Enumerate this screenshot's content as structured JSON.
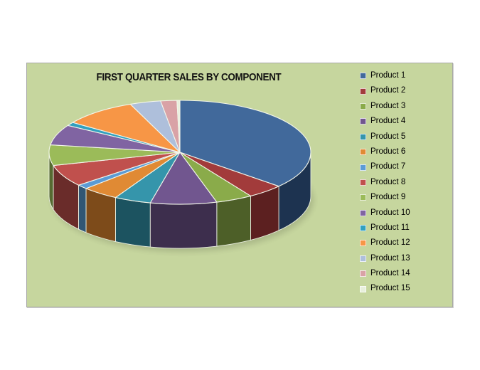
{
  "chart_data": {
    "type": "pie",
    "title": "FIRST QUARTER SALES BY COMPONENT",
    "three_d": true,
    "start_angle_deg": 0,
    "direction": "clockwise",
    "legend_position": "right",
    "grid": false,
    "categories": [
      "Product 1",
      "Product 2",
      "Product 3",
      "Product 4",
      "Product 5",
      "Product 6",
      "Product 7",
      "Product 8",
      "Product 9",
      "Product 10",
      "Product 11",
      "Product 12",
      "Product 13",
      "Product 14",
      "Product 15"
    ],
    "values": [
      40,
      5,
      5,
      9,
      5,
      5,
      1.5,
      7.5,
      7,
      7,
      1.2,
      10,
      4.2,
      2.2,
      0.4
    ],
    "colors": [
      "#41699b",
      "#a23b3b",
      "#8aab4a",
      "#71568f",
      "#3595ab",
      "#e08a34",
      "#5b9bd5",
      "#c0504d",
      "#9bbb59",
      "#8064a2",
      "#31a0bf",
      "#f79646",
      "#aebfdb",
      "#d9a2a6",
      "#e8f0dc"
    ],
    "side_colors": [
      "#1d3350",
      "#5c2020",
      "#4d5f28",
      "#3d2e4d",
      "#1c5360",
      "#7d4b1a",
      "#305674",
      "#6a2c2a",
      "#566a31",
      "#463659",
      "#1a5a6b",
      "#8a5225",
      "#5f6b7a",
      "#79595c",
      "#80877a"
    ]
  },
  "chart": {
    "background_color": "#c6d69e",
    "border_color": "#a6a6a6",
    "page_background": "#ffffff",
    "title_color": "#111111",
    "legend_text_color": "#000000"
  }
}
